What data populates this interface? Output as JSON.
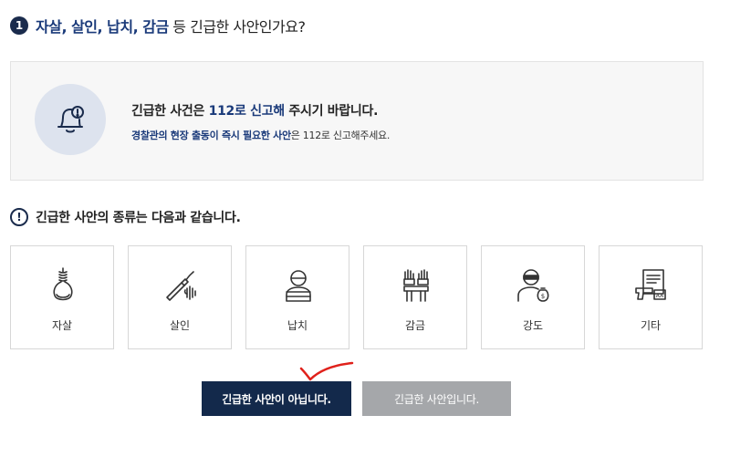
{
  "question": {
    "number": "1",
    "highlight": "자살, 살인, 납치, 감금",
    "rest": " 등 긴급한 사안인가요?"
  },
  "notice": {
    "main_prefix": "긴급한 사건은 ",
    "main_highlight": "112로 신고해",
    "main_suffix": " 주시기 바랍니다.",
    "sub_highlight": "경찰관의 현장 출동이 즉시 필요한 사안",
    "sub_suffix": "은 112로 신고해주세요."
  },
  "types": {
    "title": "긴급한 사안의 종류는 다음과 같습니다.",
    "items": [
      {
        "label": "자살",
        "icon": "noose-icon"
      },
      {
        "label": "살인",
        "icon": "knife-icon"
      },
      {
        "label": "납치",
        "icon": "kidnap-icon"
      },
      {
        "label": "감금",
        "icon": "handcuff-icon"
      },
      {
        "label": "강도",
        "icon": "robber-icon"
      },
      {
        "label": "기타",
        "icon": "other-icon"
      }
    ]
  },
  "buttons": {
    "not_urgent": "긴급한 사안이 아닙니다.",
    "urgent": "긴급한 사안입니다."
  },
  "colors": {
    "navy": "#13294b",
    "highlight": "#1a3a7a",
    "gray_button": "#a5a7aa",
    "check_mark": "#e0211b"
  }
}
